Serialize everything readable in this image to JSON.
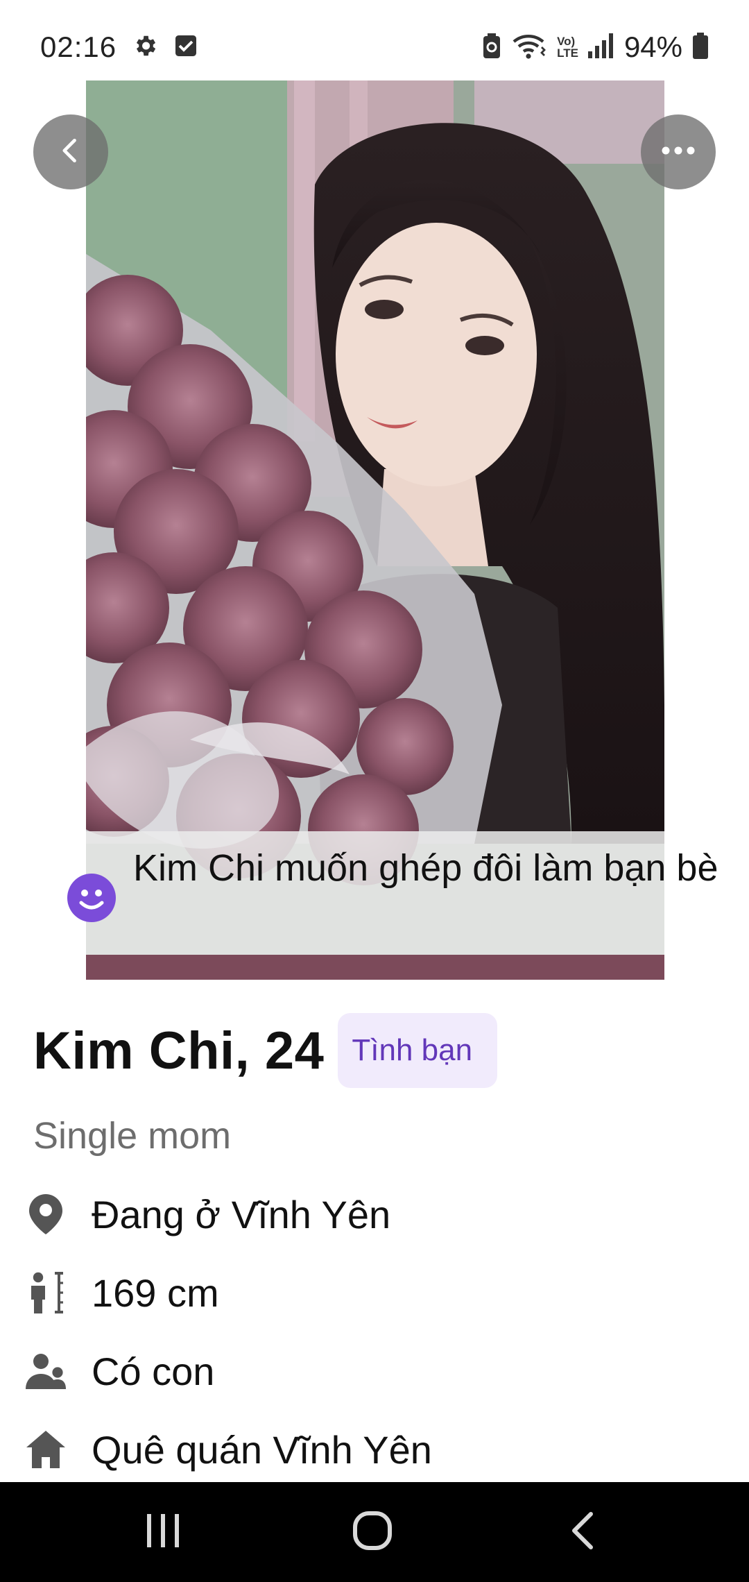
{
  "status_bar": {
    "time": "02:16",
    "battery": "94%",
    "icons": [
      "gear-icon",
      "checkbox-icon",
      "battery-saver-icon",
      "wifi-icon",
      "volte-icon",
      "signal-icon",
      "battery-icon"
    ],
    "network_label_top": "Vo)",
    "network_label_bottom": "LTE"
  },
  "photo": {
    "caption": "Kim Chi muốn ghép đôi làm bạn bè",
    "caption_icon": "smile-icon"
  },
  "profile": {
    "name_age": "Kim Chi, 24",
    "relationship_chip": "Tình bạn",
    "tagline": "Single mom",
    "details": [
      {
        "icon": "location-pin-icon",
        "text": "Đang ở Vĩnh Yên"
      },
      {
        "icon": "height-icon",
        "text": "169 cm"
      },
      {
        "icon": "children-icon",
        "text": "Có con"
      },
      {
        "icon": "home-icon",
        "text": "Quê quán Vĩnh Yên"
      }
    ]
  },
  "navigation": {
    "back_button": "back-icon",
    "more_button": "more-options-icon",
    "system_nav": [
      "recent-apps-icon",
      "home-nav-icon",
      "back-nav-icon"
    ]
  },
  "colors": {
    "accent": "#7b4cd9",
    "chip_bg": "#f1ebfc",
    "chip_text": "#6237b9",
    "secondary_text": "#6d6d6d"
  }
}
